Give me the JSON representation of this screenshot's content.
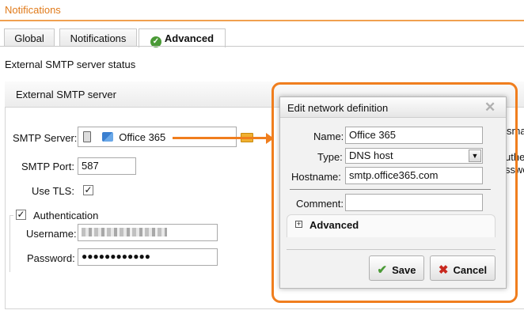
{
  "page": {
    "title": "Notifications"
  },
  "tabs": [
    {
      "label": "Global"
    },
    {
      "label": "Notifications"
    },
    {
      "label": "Advanced"
    }
  ],
  "status_heading": "External SMTP server status",
  "panel": {
    "title": "External SMTP server",
    "smtp_server_label": "SMTP Server:",
    "smtp_server_value": "Office 365",
    "smtp_port_label": "SMTP Port:",
    "smtp_port_value": "587",
    "use_tls_label": "Use TLS:",
    "use_tls_checked": true,
    "authentication_label": "Authentication",
    "authentication_checked": true,
    "username_label": "Username:",
    "password_label": "Password:",
    "password_value": "●●●●●●●●●●●●",
    "right_partial": [
      "sma",
      "uthe",
      "sswo"
    ]
  },
  "dialog": {
    "title": "Edit network definition",
    "name_label": "Name:",
    "name_value": "Office 365",
    "type_label": "Type:",
    "type_value": "DNS host",
    "hostname_label": "Hostname:",
    "hostname_value": "smtp.office365.com",
    "comment_label": "Comment:",
    "comment_value": "",
    "advanced_label": "Advanced",
    "save_label": "Save",
    "cancel_label": "Cancel"
  },
  "colors": {
    "accent": "#f07e1e",
    "ok": "#4a9a36",
    "cancel": "#c8281e"
  }
}
